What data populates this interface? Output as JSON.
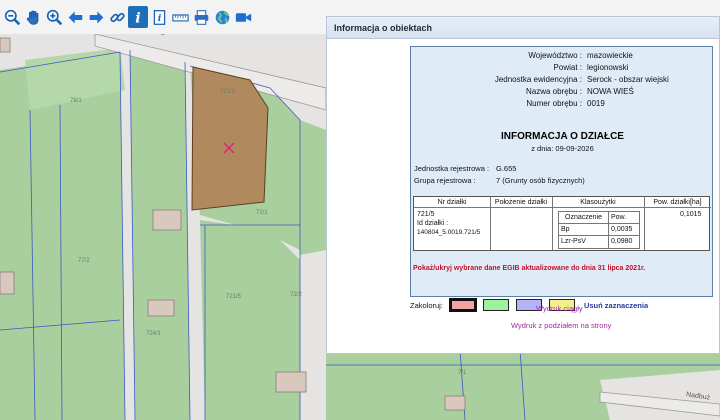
{
  "toolbar": {
    "tools": [
      {
        "name": "zoom-out-icon"
      },
      {
        "name": "pan-hand-icon"
      },
      {
        "name": "zoom-in-icon"
      },
      {
        "name": "arrow-back-icon"
      },
      {
        "name": "arrow-forward-icon"
      },
      {
        "name": "link-icon"
      },
      {
        "name": "info-icon",
        "active": true
      },
      {
        "name": "info-doc-icon"
      },
      {
        "name": "measure-icon"
      },
      {
        "name": "print-icon"
      },
      {
        "name": "globe-icon"
      },
      {
        "name": "video-icon"
      }
    ],
    "accent": "#1e6fb8"
  },
  "map": {
    "parcel_fill": "#b08a5e",
    "green_fill": "#a9cf9e",
    "labels": {
      "street_top": "polowa",
      "street_bottom": "Nadbuż",
      "l1": "78/1",
      "l2": "77/2",
      "l3": "721/1",
      "l4": "72/1",
      "l5": "72/2",
      "l6": "721/5",
      "l7": "724/1",
      "l8": "7/1"
    }
  },
  "panel": {
    "title": "Informacja o obiektach",
    "fields": {
      "wojewodztwo_label": "Województwo :",
      "wojewodztwo": "mazowieckie",
      "powiat_label": "Powiat :",
      "powiat": "legionowski",
      "jednostka_label": "Jednostka ewidencyjna :",
      "jednostka": "Serock - obszar wiejski",
      "obreb_label": "Nazwa obrębu :",
      "obreb": "NOWA WIEŚ",
      "numer_label": "Numer obrębu :",
      "numer": "0019"
    },
    "info_title": "INFORMACJA O DZIAŁCE",
    "info_date": "z dnia: 09-09-2026",
    "jr_label": "Jednostka rejestrowa :",
    "jr_value": "G.655",
    "gr_label": "Grupa rejestrowa :",
    "gr_value": "7 (Grunty osób fizycznych)",
    "table": {
      "headers": [
        "Nr działki",
        "Położenie działki",
        "Klasoużytki",
        "Pow. działki[ha]"
      ],
      "sub_headers": [
        "Oznaczenie",
        "Pow."
      ],
      "parcel_nr": "721/5",
      "parcel_id_label": "Id działki :",
      "parcel_id": "140804_5.0019.721/5",
      "classes": [
        {
          "code": "Bp",
          "area": "0,0035"
        },
        {
          "code": "Lzr-PsV",
          "area": "0,0980"
        }
      ],
      "total_area": "0,1015"
    },
    "notice": "Pokaż/ukryj wybrane dane EGIB aktualizowane do dnia 31 lipca 2021r.",
    "color_label": "Zakoloruj:",
    "swatches": [
      {
        "color": "#f4a3a3",
        "selected": true
      },
      {
        "color": "#9df29d"
      },
      {
        "color": "#b3b3f5"
      },
      {
        "color": "#f5f08f"
      }
    ],
    "clear_label": "Usuń zaznaczenia",
    "print_link": "Wydruk ciągły",
    "print_paged_link": "Wydruk z podziałem na strony"
  }
}
